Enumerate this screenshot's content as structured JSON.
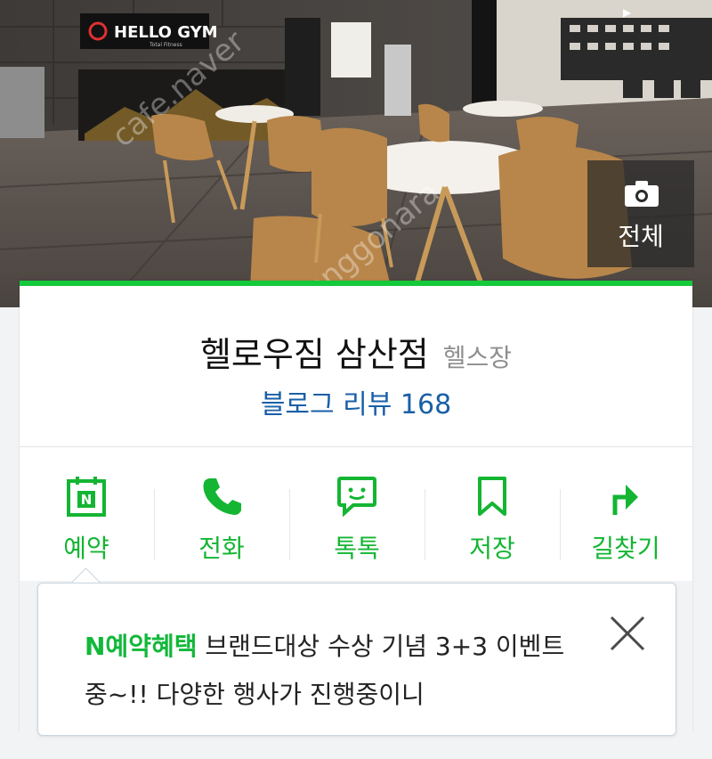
{
  "hero": {
    "sign_text": "HELLO GYM",
    "sign_sub": "Total Fitness",
    "photo_button_label": "전체",
    "photo_icon": "camera-icon"
  },
  "place": {
    "name": "헬로우짐 삼산점",
    "category": "헬스장",
    "review_link": "블로그 리뷰 168"
  },
  "actions": [
    {
      "label": "예약",
      "icon": "reservation-icon"
    },
    {
      "label": "전화",
      "icon": "phone-icon"
    },
    {
      "label": "톡톡",
      "icon": "talk-icon"
    },
    {
      "label": "저장",
      "icon": "bookmark-icon"
    },
    {
      "label": "길찾기",
      "icon": "directions-icon"
    }
  ],
  "promo": {
    "tag": "N예약혜택",
    "text": "브랜드대상 수상 기념 3+3 이벤트중~!! 다양한 행사가 진행중이니"
  },
  "colors": {
    "accent_green": "#14c93a",
    "link_blue": "#1a5fa7",
    "category_gray": "#8e8e8e"
  }
}
